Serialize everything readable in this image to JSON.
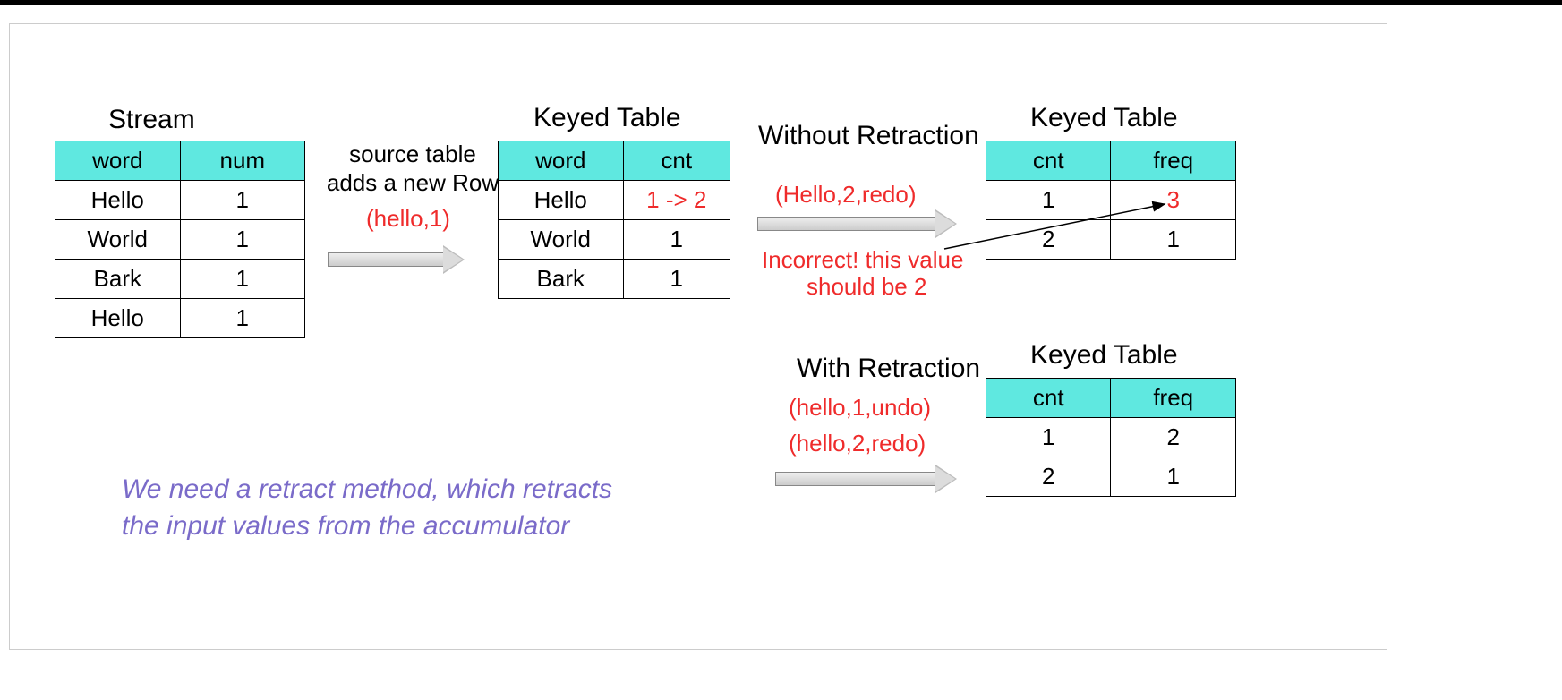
{
  "titles": {
    "stream": "Stream",
    "keyed1": "Keyed Table",
    "keyed2": "Keyed Table",
    "keyed3": "Keyed Table",
    "without": "Without Retraction",
    "with": "With Retraction"
  },
  "stream": {
    "headers": [
      "word",
      "num"
    ],
    "rows": [
      {
        "c0": "Hello",
        "c1": "1",
        "hl": false
      },
      {
        "c0": "World",
        "c1": "1",
        "hl": false
      },
      {
        "c0": "Bark",
        "c1": "1",
        "hl": false
      },
      {
        "c0": "Hello",
        "c1": "1",
        "hl": true
      }
    ]
  },
  "keyed1": {
    "headers": [
      "word",
      "cnt"
    ],
    "rows": [
      {
        "c0": "Hello",
        "c1": "1 -> 2",
        "c1_red": true
      },
      {
        "c0": "World",
        "c1": "1",
        "c1_red": false
      },
      {
        "c0": "Bark",
        "c1": "1",
        "c1_red": false
      }
    ]
  },
  "keyed2": {
    "headers": [
      "cnt",
      "freq"
    ],
    "rows": [
      {
        "c0": "1",
        "c1": "3",
        "c1_red": true
      },
      {
        "c0": "2",
        "c1": "1",
        "c1_red": false
      }
    ]
  },
  "keyed3": {
    "headers": [
      "cnt",
      "freq"
    ],
    "rows": [
      {
        "c0": "1",
        "c1": "2"
      },
      {
        "c0": "2",
        "c1": "1"
      }
    ]
  },
  "labels": {
    "source_l1": "source table",
    "source_l2": "adds a new Row",
    "new_row_tuple": "(hello,1)",
    "without_tuple": "(Hello,2,redo)",
    "incorrect_l1": "Incorrect! this value",
    "incorrect_l2": "should be 2",
    "with_tuple1": "(hello,1,undo)",
    "with_tuple2": "(hello,2,redo)",
    "footnote_l1": "We need a retract method, which retracts",
    "footnote_l2": " the input values from the accumulator"
  }
}
